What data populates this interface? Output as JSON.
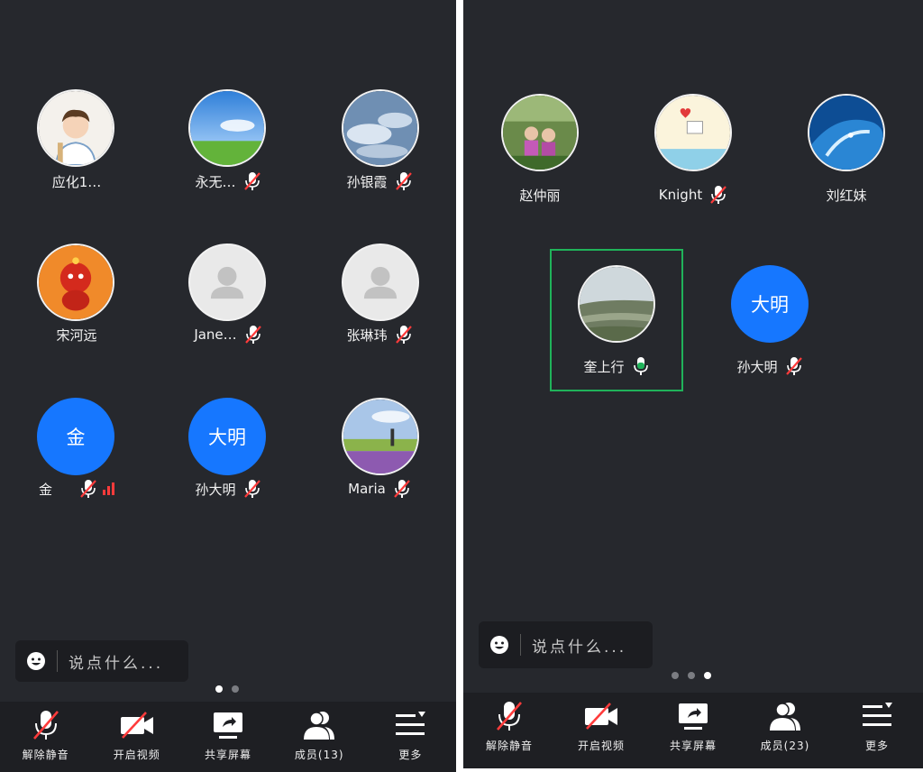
{
  "left": {
    "participants": [
      {
        "name": "应化1…",
        "avatar": "photo-boy-cartoon",
        "mic": "none"
      },
      {
        "name": "永无…",
        "avatar": "photo-sky-field",
        "mic": "muted"
      },
      {
        "name": "孙银霞",
        "avatar": "photo-clouds",
        "mic": "muted"
      },
      {
        "name": "宋河远",
        "avatar": "photo-cartoon-red",
        "mic": "none"
      },
      {
        "name": "Jane…",
        "avatar": "placeholder-person",
        "mic": "muted"
      },
      {
        "name": "张琳玮",
        "avatar": "placeholder-person",
        "mic": "muted"
      },
      {
        "name": "金",
        "avatar_text": "金",
        "mic": "muted",
        "signal": "weak"
      },
      {
        "name": "孙大明",
        "avatar_text": "大明",
        "mic": "muted"
      },
      {
        "name": "Maria",
        "avatar": "photo-flower-field",
        "mic": "muted"
      }
    ],
    "chat_placeholder": "说点什么...",
    "page_dots": 2,
    "active_dot": 0,
    "toolbar": [
      {
        "label": "解除静音",
        "icon": "mic-muted-icon"
      },
      {
        "label": "开启视频",
        "icon": "video-off-icon"
      },
      {
        "label": "共享屏幕",
        "icon": "share-screen-icon"
      },
      {
        "label": "成员(13)",
        "icon": "members-icon"
      },
      {
        "label": "更多",
        "icon": "more-menu-icon"
      }
    ]
  },
  "right": {
    "participants": [
      {
        "name": "赵仲丽",
        "avatar": "photo-children",
        "mic": "none"
      },
      {
        "name": "Knight",
        "avatar": "photo-heart-card",
        "mic": "muted"
      },
      {
        "name": "刘红妹",
        "avatar": "photo-surf-wave",
        "mic": "none"
      },
      {
        "name": "奎上行",
        "avatar": "photo-landscape",
        "mic": "active",
        "speaking": true
      },
      {
        "name": "孙大明",
        "avatar_text": "大明",
        "mic": "muted"
      }
    ],
    "chat_placeholder": "说点什么...",
    "page_dots": 3,
    "active_dot": 2,
    "toolbar": [
      {
        "label": "解除静音",
        "icon": "mic-muted-icon"
      },
      {
        "label": "开启视频",
        "icon": "video-off-icon"
      },
      {
        "label": "共享屏幕",
        "icon": "share-screen-icon"
      },
      {
        "label": "成员(23)",
        "icon": "members-icon"
      },
      {
        "label": "更多",
        "icon": "more-menu-icon"
      }
    ]
  },
  "colors": {
    "background": "#26282d",
    "toolbar_bg": "#1e1f23",
    "avatar_blue": "#1677ff",
    "mute_red": "#ff3b3b",
    "speaking_green": "#20b35a"
  }
}
